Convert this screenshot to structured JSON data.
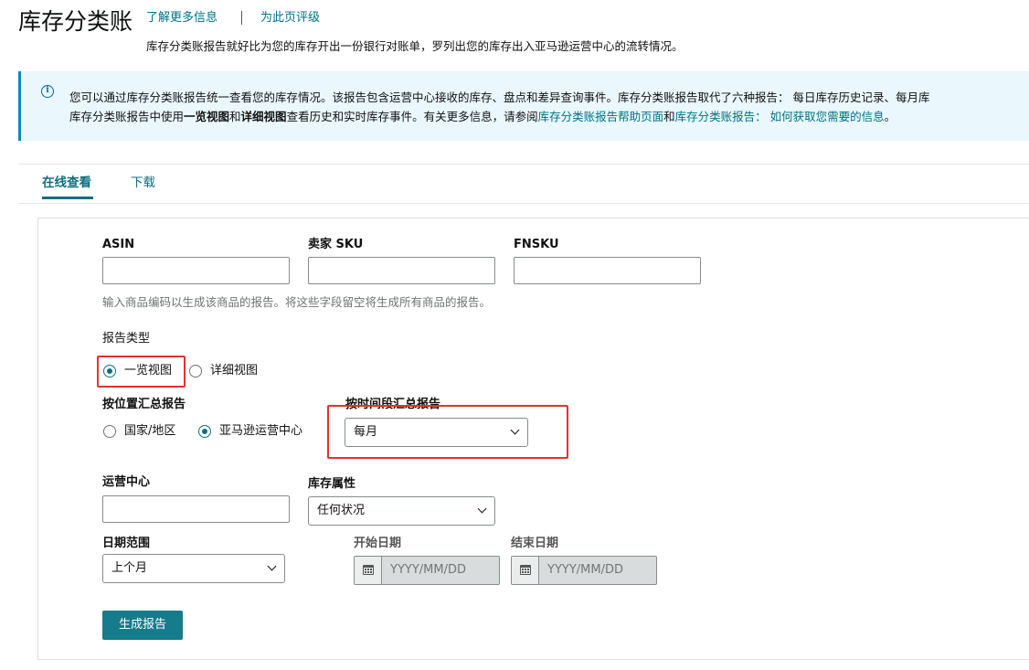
{
  "header": {
    "title": "库存分类账",
    "learn_more": "了解更多信息",
    "rate_page": "为此页评级",
    "subtitle": "库存分类账报告就好比为您的库存开出一份银行对账单，罗列出您的库存出入亚马逊运营中心的流转情况。"
  },
  "banner": {
    "line1": "您可以通过库存分类账报告统一查看您的库存情况。该报告包含运营中心接收的库存、盘点和差异查询事件。库存分类账报告取代了六种报告： 每日库存历史记录、每月库",
    "line2_a": "库存分类账报告中使用",
    "line2_b": "一览视图",
    "line2_c": "和",
    "line2_d": "详细视图",
    "line2_e": "查看历史和实时库存事件。有关更多信息，请参阅",
    "line2_link1": "库存分类账报告帮助页面",
    "line2_f": "和",
    "line2_link2": "库存分类账报告： 如何获取您需要的信息",
    "line2_g": "。"
  },
  "tabs": {
    "online": "在线查看",
    "download": "下载"
  },
  "form": {
    "asin_label": "ASIN",
    "sku_label": "卖家 SKU",
    "fnsku_label": "FNSKU",
    "helper": "输入商品编码以生成该商品的报告。将这些字段留空将生成所有商品的报告。",
    "report_type_label": "报告类型",
    "report_type_summary": "一览视图",
    "report_type_detail": "详细视图",
    "by_location_label": "按位置汇总报告",
    "location_country": "国家/地区",
    "location_fc": "亚马逊运营中心",
    "by_period_label": "按时间段汇总报告",
    "period_value": "每月",
    "fc_label": "运营中心",
    "inventory_attr_label": "库存属性",
    "inventory_attr_value": "任何状况",
    "date_range_label": "日期范围",
    "date_range_value": "上个月",
    "start_date_label": "开始日期",
    "end_date_label": "结束日期",
    "date_placeholder": "YYYY/MM/DD",
    "generate_button": "生成报告"
  },
  "colors": {
    "accent": "#0f6f7d",
    "link": "#007185",
    "banner_bg": "#eaf7fc",
    "highlight": "#e0332e",
    "button": "#167b8a"
  }
}
